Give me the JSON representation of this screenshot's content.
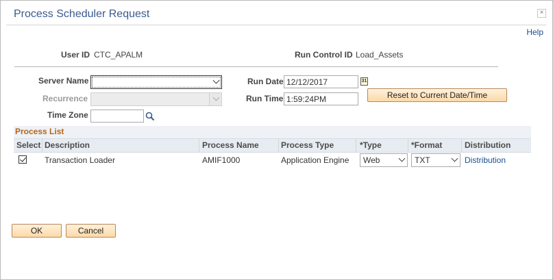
{
  "dialog": {
    "title": "Process Scheduler Request",
    "close_label": "×",
    "help_label": "Help"
  },
  "header": {
    "user_id_label": "User ID",
    "user_id_value": "CTC_APALM",
    "run_control_label": "Run Control ID",
    "run_control_value": "Load_Assets"
  },
  "form": {
    "server_name_label": "Server Name",
    "server_name_value": "",
    "recurrence_label": "Recurrence",
    "recurrence_value": "",
    "time_zone_label": "Time Zone",
    "time_zone_value": "",
    "run_date_label": "Run Date",
    "run_date_value": "12/12/2017",
    "calendar_glyph": "31",
    "run_time_label": "Run Time",
    "run_time_value": "1:59:24PM",
    "reset_button_label": "Reset to Current Date/Time"
  },
  "process_list": {
    "title": "Process List",
    "columns": [
      "Select",
      "Description",
      "Process Name",
      "Process Type",
      "*Type",
      "*Format",
      "Distribution"
    ],
    "rows": [
      {
        "selected": true,
        "description": "Transaction Loader",
        "process_name": "AMIF1000",
        "process_type": "Application Engine",
        "type": "Web",
        "format": "TXT",
        "distribution": "Distribution"
      }
    ]
  },
  "footer": {
    "ok_label": "OK",
    "cancel_label": "Cancel"
  },
  "colors": {
    "title": "#3a5a8c",
    "link": "#1a4f8c",
    "section_title": "#b5651d",
    "button_fill": "#fcd9a8"
  },
  "icons": {
    "calendar": "calendar-icon",
    "search": "search-icon",
    "dropdown": "chevron-down-icon",
    "close": "close-icon",
    "checkbox": "checkmark-icon"
  }
}
